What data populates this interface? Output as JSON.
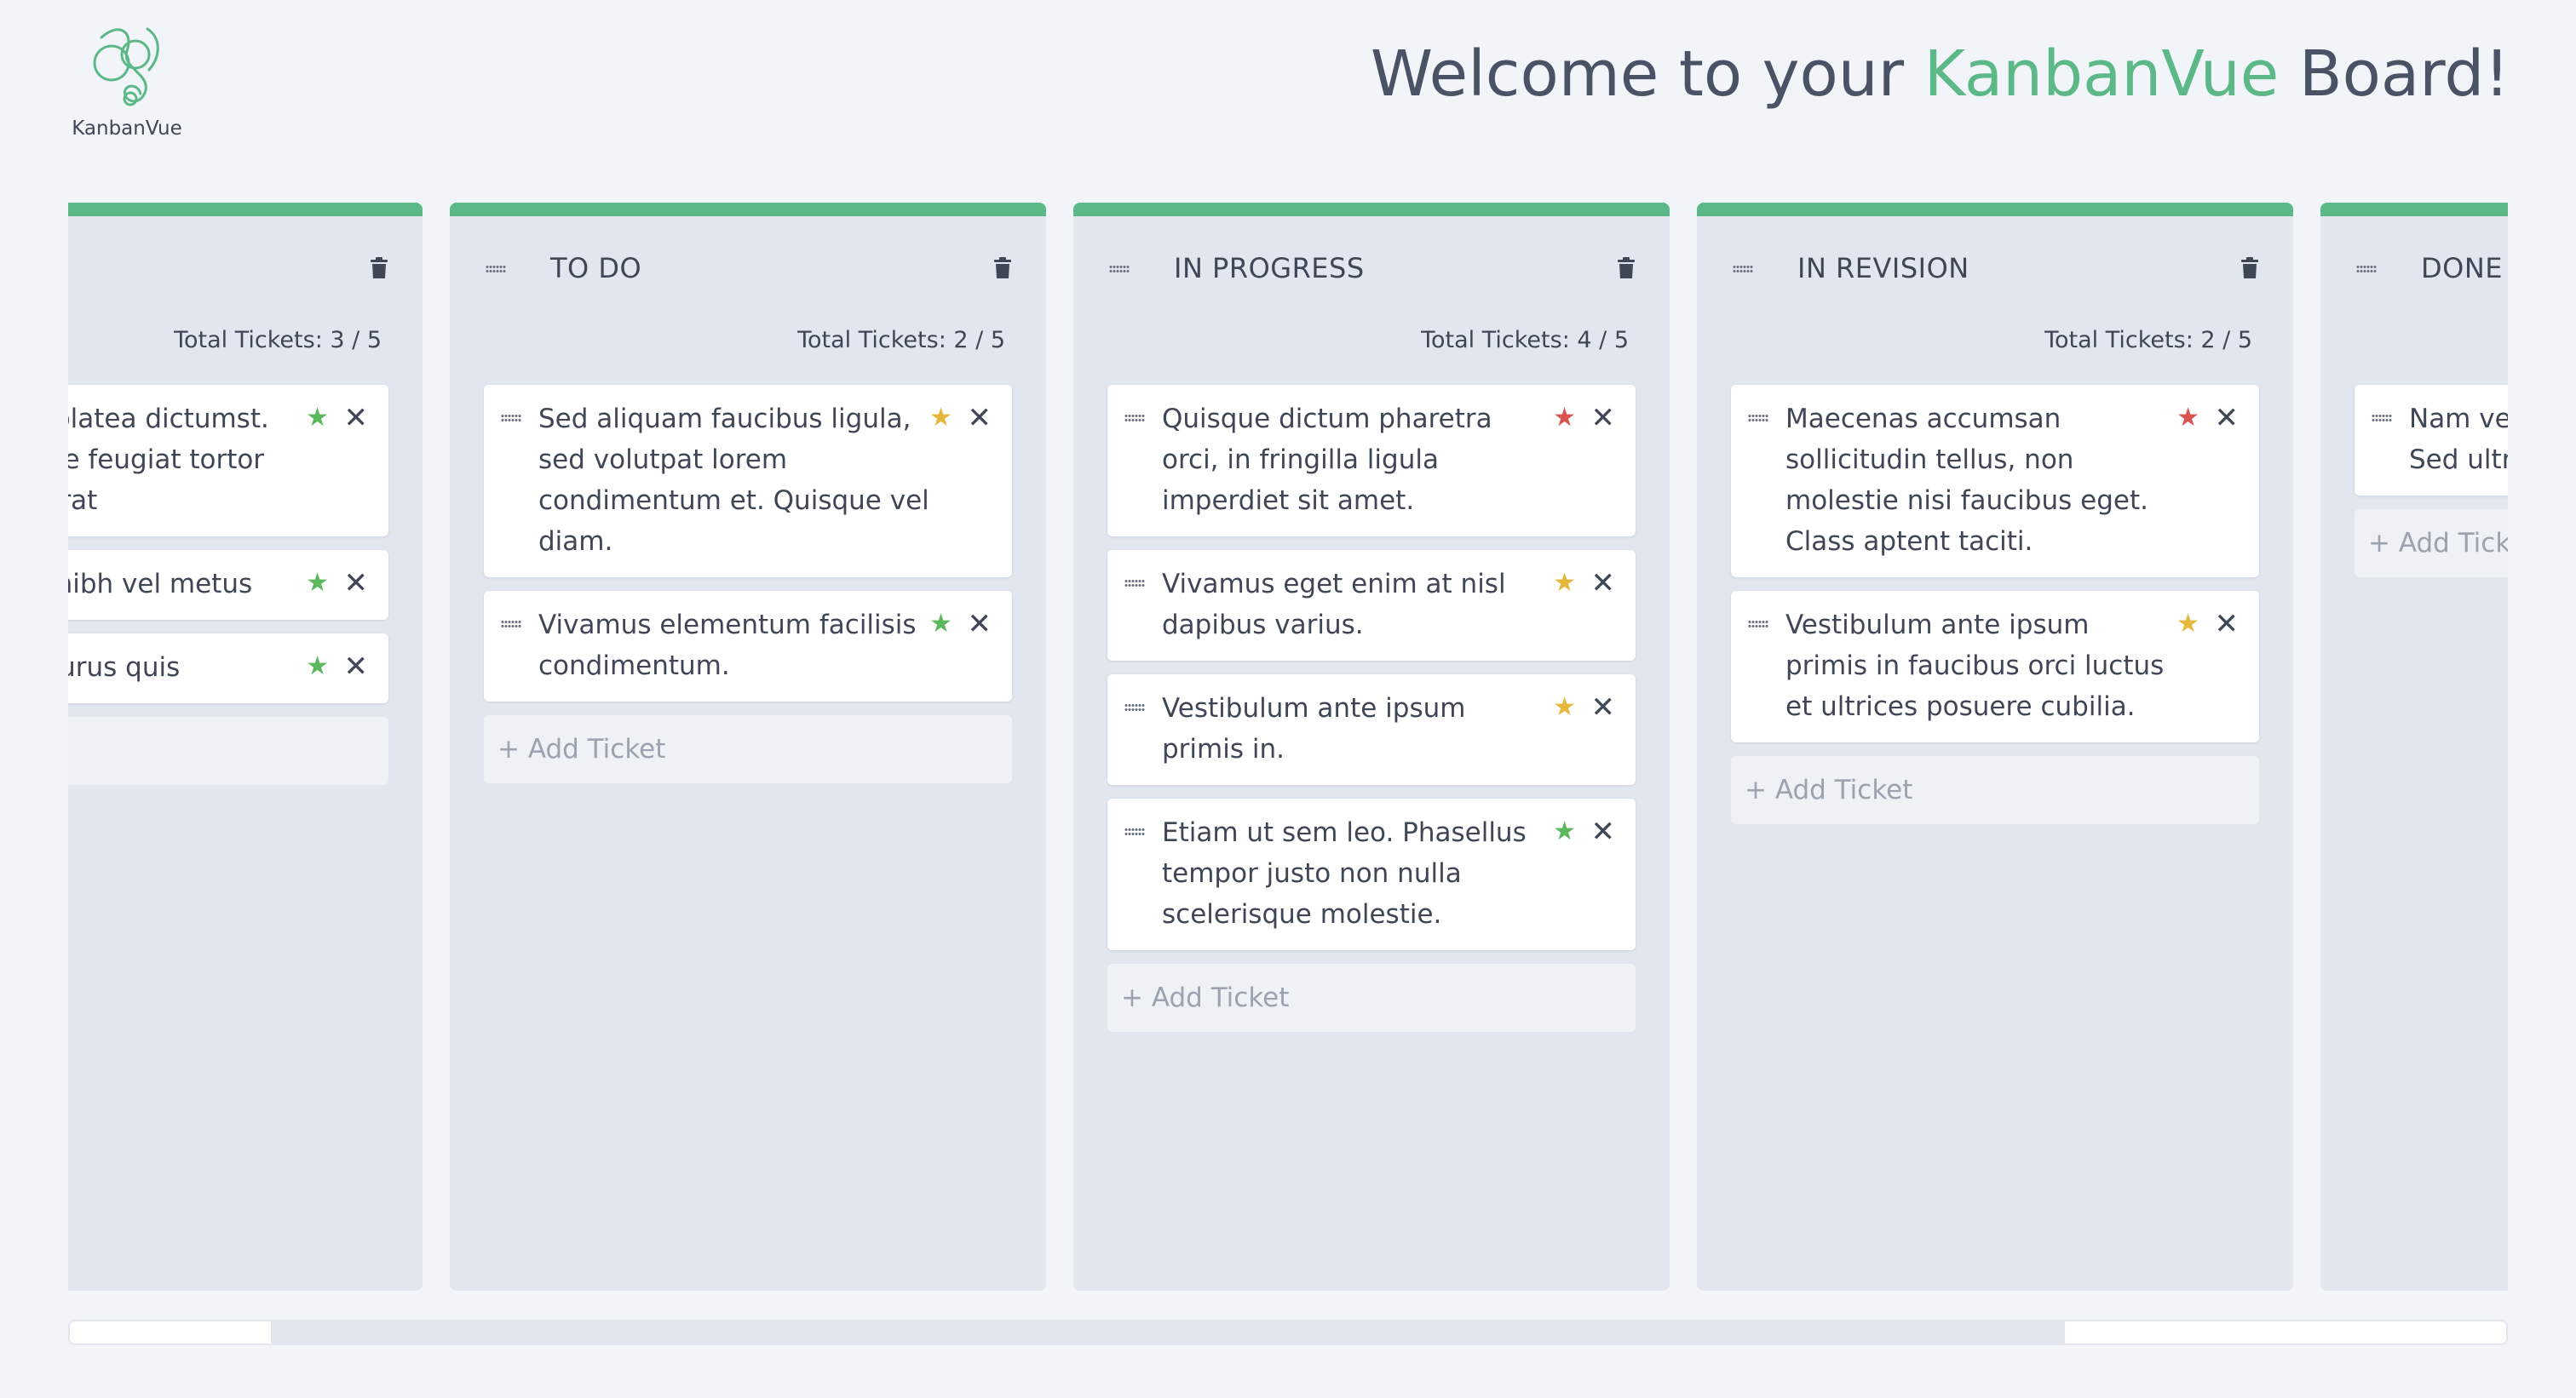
{
  "app": {
    "logo_text": "KanbanVue",
    "welcome_prefix": "Welcome to your ",
    "welcome_brand": "KanbanVue",
    "welcome_suffix": " Board!",
    "brand_color": "#5cb887"
  },
  "colors": {
    "star_green": "#5cb85c",
    "star_yellow": "#e5b73b",
    "star_red": "#d9534f"
  },
  "columns": [
    {
      "title": "",
      "count": "Total Tickets: 3 / 5",
      "tickets": [
        {
          "text": "Habitasse platea dictumst. Suspendisse feugiat tortor vitae placerat",
          "priority": "green"
        },
        {
          "text": "Maecenas nibh vel metus",
          "priority": "green"
        },
        {
          "text": "Donec at purus quis",
          "priority": "green"
        }
      ],
      "add_label": ""
    },
    {
      "title": "TO DO",
      "count": "Total Tickets: 2 / 5",
      "tickets": [
        {
          "text": "Sed aliquam faucibus ligula, sed volutpat lorem condimentum et. Quisque vel diam.",
          "priority": "yellow"
        },
        {
          "text": "Vivamus elementum facilisis condimentum.",
          "priority": "green"
        }
      ],
      "add_label": "+ Add Ticket"
    },
    {
      "title": "IN PROGRESS",
      "count": "Total Tickets: 4 / 5",
      "tickets": [
        {
          "text": "Quisque dictum pharetra orci, in fringilla ligula imperdiet sit amet.",
          "priority": "red"
        },
        {
          "text": "Vivamus eget enim at nisl dapibus varius.",
          "priority": "yellow"
        },
        {
          "text": "Vestibulum ante ipsum primis in.",
          "priority": "yellow"
        },
        {
          "text": "Etiam ut sem leo. Phasellus tempor justo non nulla scelerisque molestie.",
          "priority": "green"
        }
      ],
      "add_label": "+ Add Ticket"
    },
    {
      "title": "IN REVISION",
      "count": "Total Tickets: 2 / 5",
      "tickets": [
        {
          "text": "Maecenas accumsan sollicitudin tellus, non molestie nisi faucibus eget. Class aptent taciti.",
          "priority": "red"
        },
        {
          "text": "Vestibulum ante ipsum primis in faucibus orci luctus et ultrices posuere cubilia.",
          "priority": "yellow"
        }
      ],
      "add_label": "+ Add Ticket"
    },
    {
      "title": "DONE",
      "count": "",
      "tickets": [
        {
          "text": "Nam vel ultricies luctus mi. Sed ultrices.",
          "priority": "green"
        }
      ],
      "add_label": "+ Add Ticket"
    }
  ]
}
